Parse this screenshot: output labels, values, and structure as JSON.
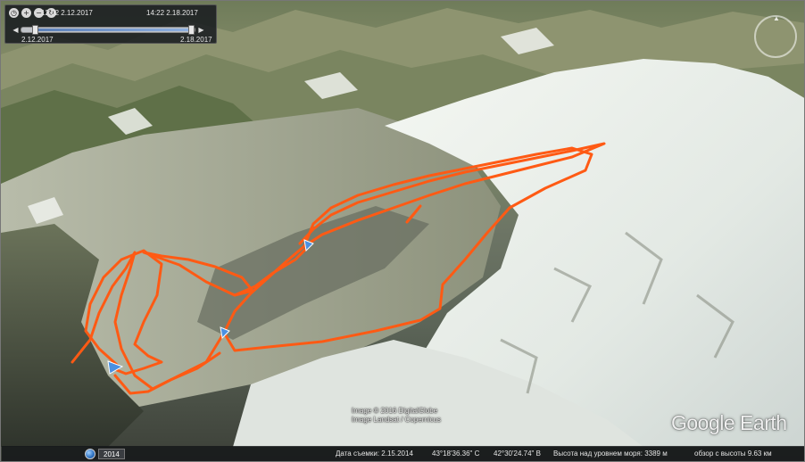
{
  "time_slider": {
    "start_time": "12:02 2.12.2017",
    "end_time": "14:22 2.18.2017",
    "start_date": "2.12.2017",
    "end_date": "2.18.2017",
    "icons": [
      "clock-icon",
      "zoom-in-icon",
      "zoom-out-icon",
      "refresh-icon"
    ]
  },
  "attribution": {
    "line1": "Image © 2016 DigitalGlobe",
    "line2": "Image Landsat / Copernicus"
  },
  "logo": "Google Earth",
  "status": {
    "year": "2014",
    "imagery_date": "Дата съемки: 2.15.2014",
    "lat": "43°18'36.36\" С",
    "lon": "42°30'24.74\" В",
    "elevation": "Высота над уровнем моря: 3389 м",
    "eye_alt": "обзор с высоты 9.63 км"
  },
  "colors": {
    "track": "#ff5a14",
    "panel_bg": "#191c20",
    "marker": "#4a90e2"
  }
}
